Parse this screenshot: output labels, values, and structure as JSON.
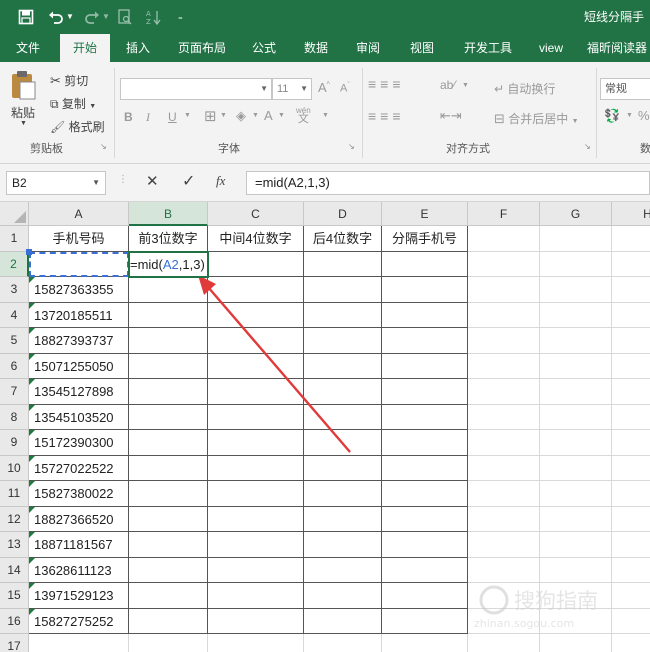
{
  "window": {
    "title": "短线分隔手",
    "accent": "#217346"
  },
  "qat": {
    "save_icon": "save-icon",
    "undo_icon": "undo-icon",
    "redo_icon": "redo-icon",
    "print_preview_icon": "print-preview-icon",
    "sort_icon": "sort-icon",
    "customize_icon": "chevron-down-icon"
  },
  "tabs": [
    {
      "label": "文件"
    },
    {
      "label": "开始",
      "active": true
    },
    {
      "label": "插入"
    },
    {
      "label": "页面布局"
    },
    {
      "label": "公式"
    },
    {
      "label": "数据"
    },
    {
      "label": "审阅"
    },
    {
      "label": "视图"
    },
    {
      "label": "开发工具"
    },
    {
      "label": "view"
    },
    {
      "label": "福昕阅读器"
    }
  ],
  "ribbon": {
    "clipboard": {
      "paste": "粘贴",
      "cut": "剪切",
      "copy": "复制",
      "format_painter": "格式刷",
      "group_label": "剪贴板"
    },
    "font": {
      "font_name": "",
      "font_size": "11",
      "grow": "A",
      "shrink": "A",
      "bold": "B",
      "italic": "I",
      "underline": "U",
      "font_color": "A",
      "phonetic": "wén",
      "group_label": "字体"
    },
    "alignment": {
      "wrap_text": "自动换行",
      "merge_center": "合并后居中",
      "group_label": "对齐方式"
    },
    "number": {
      "format": "常规",
      "percent": "%",
      "group_label": "数"
    }
  },
  "formula_bar": {
    "name_box": "B2",
    "cancel": "✕",
    "enter": "✓",
    "fx": "fx",
    "formula": "=mid(A2,1,3)"
  },
  "sheet": {
    "columns": [
      "A",
      "B",
      "C",
      "D",
      "E",
      "F",
      "G",
      "H"
    ],
    "rows": [
      "1",
      "2",
      "3",
      "4",
      "5",
      "6",
      "7",
      "8",
      "9",
      "10",
      "11",
      "12",
      "13",
      "14",
      "15",
      "16",
      "17"
    ],
    "headers": [
      "手机号码",
      "前3位数字",
      "中间4位数字",
      "后4位数字",
      "分隔手机号"
    ],
    "edit_cell": {
      "prefix": "=mid(",
      "ref": "A2",
      "suffix": ",1,3)"
    },
    "phones": [
      "15827363355",
      "13720185511",
      "18827393737",
      "15071255050",
      "13545127898",
      "13545103520",
      "15172390300",
      "15727022522",
      "15827380022",
      "18827366520",
      "18871181567",
      "13628611123",
      "13971529123",
      "15827275252"
    ]
  }
}
